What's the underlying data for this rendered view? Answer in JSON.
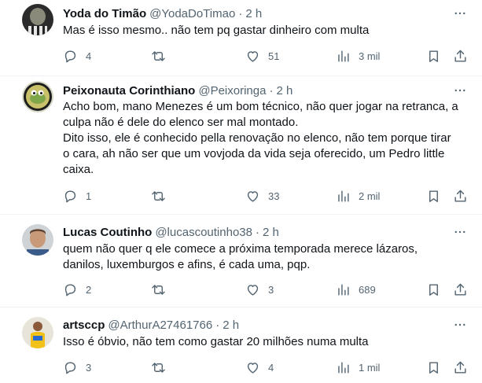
{
  "tweets": [
    {
      "name": "Yoda do Timão",
      "handle": "@YodaDoTimao",
      "dot": "·",
      "time": "2 h",
      "text": "Mas é isso mesmo.. não tem pq gastar dinheiro com multa",
      "replies": "4",
      "retweets": "",
      "likes": "51",
      "views": "3 mil"
    },
    {
      "name": "Peixonauta Corinthiano",
      "handle": "@Peixoringa",
      "dot": "·",
      "time": "2 h",
      "text": "Acho bom, mano Menezes é um bom técnico, não quer jogar na retranca, a\nculpa não é dele do elenco ser mal montado.\nDito isso, ele é conhecido pella renovação no elenco, não tem porque tirar\no cara, ah não ser que um vovjoda da vida seja oferecido, um Pedro little\ncaixa.",
      "replies": "1",
      "retweets": "",
      "likes": "33",
      "views": "2 mil"
    },
    {
      "name": "Lucas Coutinho",
      "handle": "@lucascoutinho38",
      "dot": "·",
      "time": "2 h",
      "text": "quem não quer q ele comece a próxima temporada merece lázaros,\ndanilos, luxemburgos e afins, é cada uma, pqp.",
      "replies": "2",
      "retweets": "",
      "likes": "3",
      "views": "689"
    },
    {
      "name": "artsccp",
      "handle": "@ArthurA27461766",
      "dot": "·",
      "time": "2 h",
      "text": "Isso é óbvio, não tem como gastar 20 milhões numa multa",
      "replies": "3",
      "retweets": "",
      "likes": "4",
      "views": "1 mil"
    }
  ],
  "icons": {
    "reply": "reply-icon",
    "retweet": "retweet-icon",
    "like": "heart-icon",
    "views": "views-chart-icon",
    "bookmark": "bookmark-icon",
    "share": "share-icon",
    "more": "more-icon"
  },
  "colors": {
    "text": "#0f1419",
    "secondary": "#536471",
    "divider": "#eff3f4"
  }
}
